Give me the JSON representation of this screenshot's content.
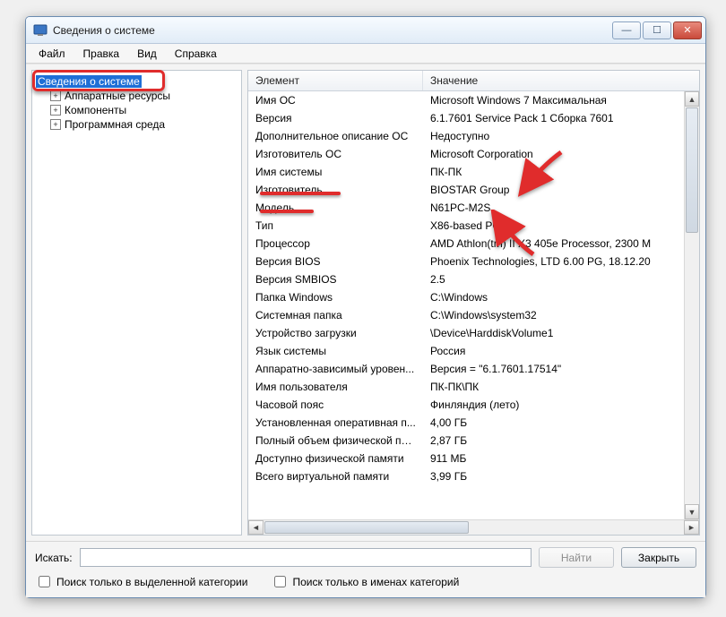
{
  "window": {
    "title": "Сведения о системе"
  },
  "menubar": {
    "items": [
      "Файл",
      "Правка",
      "Вид",
      "Справка"
    ]
  },
  "tree": {
    "root": "Сведения о системе",
    "children": [
      "Аппаратные ресурсы",
      "Компоненты",
      "Программная среда"
    ]
  },
  "details": {
    "headers": {
      "element": "Элемент",
      "value": "Значение"
    },
    "rows": [
      {
        "el": "Имя ОС",
        "val": "Microsoft Windows 7 Максимальная"
      },
      {
        "el": "Версия",
        "val": "6.1.7601 Service Pack 1 Сборка 7601"
      },
      {
        "el": "Дополнительное описание ОС",
        "val": "Недоступно"
      },
      {
        "el": "Изготовитель ОС",
        "val": "Microsoft Corporation"
      },
      {
        "el": "Имя системы",
        "val": "ПК-ПК"
      },
      {
        "el": "Изготовитель",
        "val": "BIOSTAR Group"
      },
      {
        "el": "Модель",
        "val": "N61PC-M2S"
      },
      {
        "el": "Тип",
        "val": "X86-based PC"
      },
      {
        "el": "Процессор",
        "val": "AMD Athlon(tm) II X3 405e Processor, 2300 М"
      },
      {
        "el": "Версия BIOS",
        "val": "Phoenix Technologies, LTD 6.00 PG, 18.12.20"
      },
      {
        "el": "Версия SMBIOS",
        "val": "2.5"
      },
      {
        "el": "Папка Windows",
        "val": "C:\\Windows"
      },
      {
        "el": "Системная папка",
        "val": "C:\\Windows\\system32"
      },
      {
        "el": "Устройство загрузки",
        "val": "\\Device\\HarddiskVolume1"
      },
      {
        "el": "Язык системы",
        "val": "Россия"
      },
      {
        "el": "Аппаратно-зависимый уровен...",
        "val": "Версия = \"6.1.7601.17514\""
      },
      {
        "el": "Имя пользователя",
        "val": "ПК-ПК\\ПК"
      },
      {
        "el": "Часовой пояс",
        "val": "Финляндия (лето)"
      },
      {
        "el": "Установленная оперативная п...",
        "val": "4,00 ГБ"
      },
      {
        "el": "Полный объем физической па...",
        "val": "2,87 ГБ"
      },
      {
        "el": "Доступно физической памяти",
        "val": "911 МБ"
      },
      {
        "el": "Всего виртуальной памяти",
        "val": "3,99 ГБ"
      }
    ]
  },
  "bottom": {
    "find_label": "Искать:",
    "find_button": "Найти",
    "close_button": "Закрыть",
    "check_selected_category": "Поиск только в выделенной категории",
    "check_names_only": "Поиск только в именах категорий"
  }
}
